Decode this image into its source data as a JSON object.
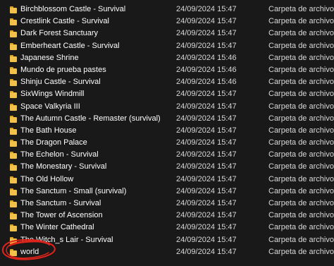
{
  "colors": {
    "background": "#191919",
    "folder": "#f2c14a",
    "annotation": "#e0241b"
  },
  "files": [
    {
      "name": "Birchblossom Castle - Survival",
      "date": "24/09/2024 15:47",
      "type": "Carpeta de archivos",
      "icon": "folder-icon"
    },
    {
      "name": "Crestlink Castle - Survival",
      "date": "24/09/2024 15:47",
      "type": "Carpeta de archivos",
      "icon": "folder-icon"
    },
    {
      "name": "Dark Forest Sanctuary",
      "date": "24/09/2024 15:47",
      "type": "Carpeta de archivos",
      "icon": "folder-icon"
    },
    {
      "name": "Emberheart Castle - Survival",
      "date": "24/09/2024 15:47",
      "type": "Carpeta de archivos",
      "icon": "folder-icon"
    },
    {
      "name": "Japanese Shrine",
      "date": "24/09/2024 15:46",
      "type": "Carpeta de archivos",
      "icon": "folder-icon"
    },
    {
      "name": "Mundo de prueba pastes",
      "date": "24/09/2024 15:46",
      "type": "Carpeta de archivos",
      "icon": "folder-icon"
    },
    {
      "name": "Shinju Castle - Survival",
      "date": "24/09/2024 15:46",
      "type": "Carpeta de archivos",
      "icon": "folder-icon"
    },
    {
      "name": "SixWings Windmill",
      "date": "24/09/2024 15:47",
      "type": "Carpeta de archivos",
      "icon": "folder-icon"
    },
    {
      "name": "Space Valkyria III",
      "date": "24/09/2024 15:47",
      "type": "Carpeta de archivos",
      "icon": "folder-icon"
    },
    {
      "name": "The Autumn Castle - Remaster (survival)",
      "date": "24/09/2024 15:47",
      "type": "Carpeta de archivos",
      "icon": "folder-icon"
    },
    {
      "name": "The Bath House",
      "date": "24/09/2024 15:47",
      "type": "Carpeta de archivos",
      "icon": "folder-icon"
    },
    {
      "name": "The Dragon Palace",
      "date": "24/09/2024 15:47",
      "type": "Carpeta de archivos",
      "icon": "folder-icon"
    },
    {
      "name": "The Echelon - Survival",
      "date": "24/09/2024 15:47",
      "type": "Carpeta de archivos",
      "icon": "folder-icon"
    },
    {
      "name": "The Monestary - Survival",
      "date": "24/09/2024 15:47",
      "type": "Carpeta de archivos",
      "icon": "folder-icon"
    },
    {
      "name": "The Old Hollow",
      "date": "24/09/2024 15:47",
      "type": "Carpeta de archivos",
      "icon": "folder-icon"
    },
    {
      "name": "The Sanctum - Small (survival)",
      "date": "24/09/2024 15:47",
      "type": "Carpeta de archivos",
      "icon": "folder-icon"
    },
    {
      "name": "The Sanctum - Survival",
      "date": "24/09/2024 15:47",
      "type": "Carpeta de archivos",
      "icon": "folder-icon"
    },
    {
      "name": "The Tower of Ascension",
      "date": "24/09/2024 15:47",
      "type": "Carpeta de archivos",
      "icon": "folder-icon"
    },
    {
      "name": "The Winter Cathedral",
      "date": "24/09/2024 15:47",
      "type": "Carpeta de archivos",
      "icon": "folder-icon"
    },
    {
      "name": "The Witch_s Lair - Survival",
      "date": "24/09/2024 15:47",
      "type": "Carpeta de archivos",
      "icon": "folder-icon"
    },
    {
      "name": "world",
      "date": "24/09/2024 15:47",
      "type": "Carpeta de archivos",
      "icon": "folder-icon"
    }
  ],
  "annotation": {
    "target": "world",
    "shape": "circle"
  }
}
